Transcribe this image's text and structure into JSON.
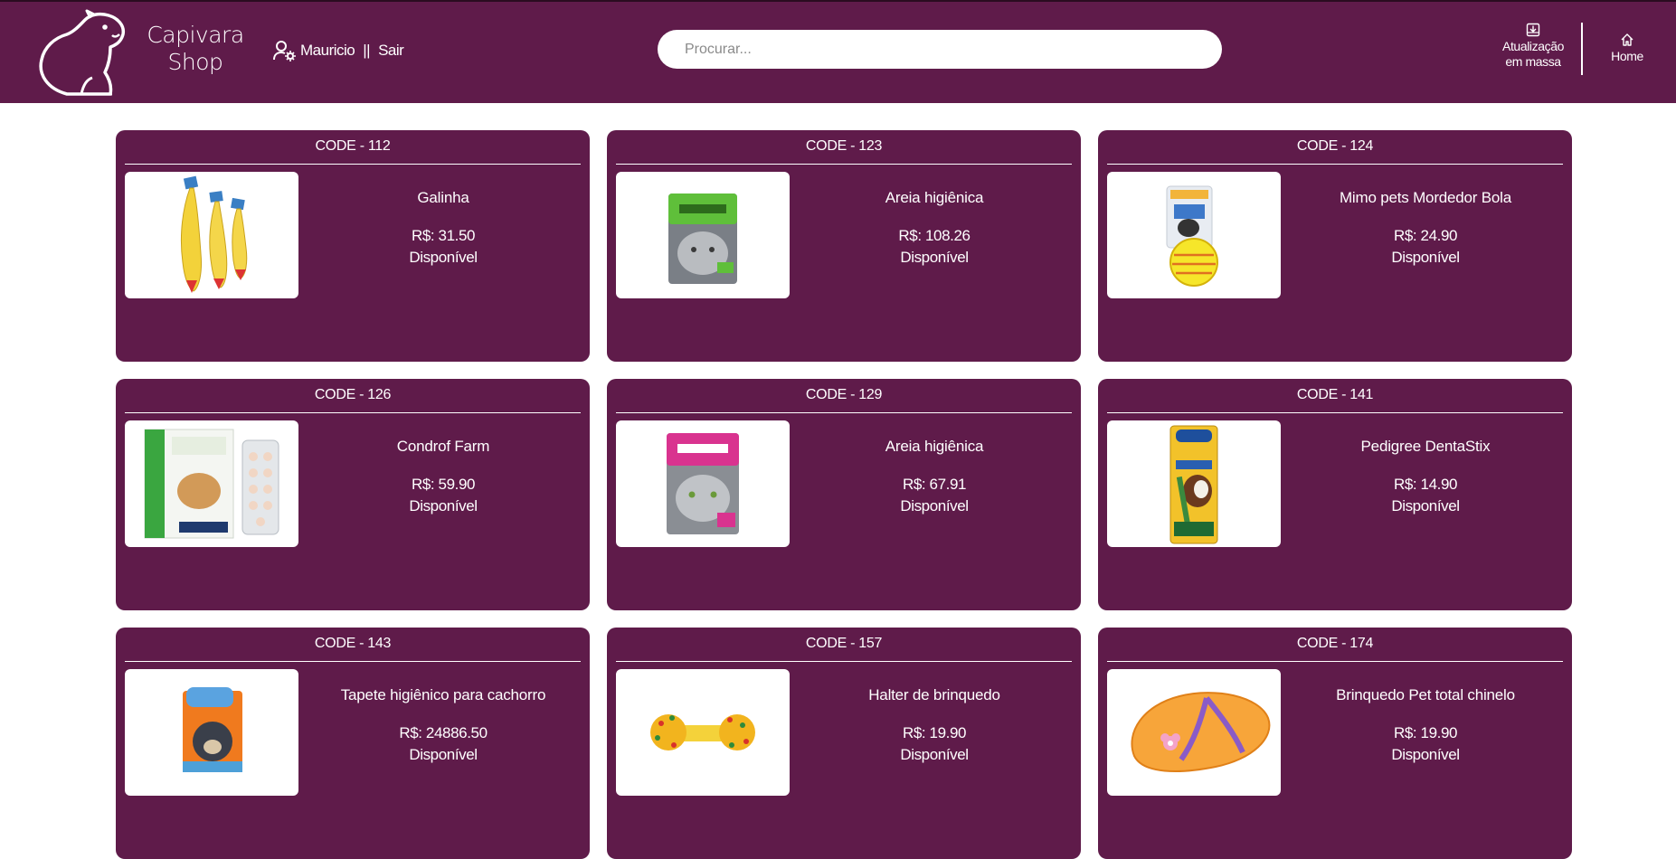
{
  "header": {
    "brand_line1": "Capivara",
    "brand_line2": "Shop",
    "user_name": "Mauricio",
    "separator": "||",
    "logout_label": "Sair",
    "search_placeholder": "Procurar...",
    "bulk_update_line1": "Atualização",
    "bulk_update_line2": "em massa",
    "home_label": "Home"
  },
  "price_prefix": "R$:",
  "products": [
    {
      "code": "CODE - 112",
      "name": "Galinha",
      "price": "R$: 31.50",
      "status": "Disponível",
      "image": "rubber-chicken-toys"
    },
    {
      "code": "CODE - 123",
      "name": "Areia higiênica",
      "price": "R$: 108.26",
      "status": "Disponível",
      "image": "cat-litter-bag-green"
    },
    {
      "code": "CODE - 124",
      "name": "Mimo pets Mordedor Bola",
      "price": "R$: 24.90",
      "status": "Disponível",
      "image": "chew-ball-toy"
    },
    {
      "code": "CODE - 126",
      "name": "Condrof Farm",
      "price": "R$: 59.90",
      "status": "Disponível",
      "image": "condrofarm-box-tablets"
    },
    {
      "code": "CODE - 129",
      "name": "Areia higiênica",
      "price": "R$: 67.91",
      "status": "Disponível",
      "image": "cat-litter-bag-pink"
    },
    {
      "code": "CODE - 141",
      "name": "Pedigree DentaStix",
      "price": "R$: 14.90",
      "status": "Disponível",
      "image": "dentastix-pack"
    },
    {
      "code": "CODE - 143",
      "name": "Tapete higiênico para cachorro",
      "price": "R$: 24886.50",
      "status": "Disponível",
      "image": "dog-pad-pack"
    },
    {
      "code": "CODE - 157",
      "name": "Halter de brinquedo",
      "price": "R$: 19.90",
      "status": "Disponível",
      "image": "toy-dumbbell"
    },
    {
      "code": "CODE - 174",
      "name": "Brinquedo Pet total chinelo",
      "price": "R$: 19.90",
      "status": "Disponível",
      "image": "flip-flop-toy"
    }
  ],
  "colors": {
    "primary": "#5f1b4a",
    "text": "#ffffff",
    "background": "#ffffff"
  }
}
